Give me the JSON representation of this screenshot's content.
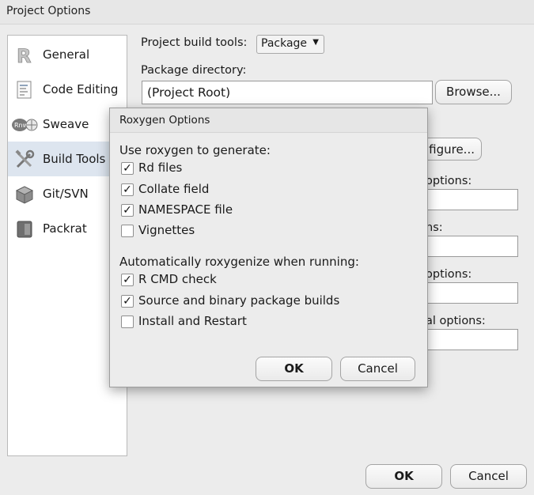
{
  "window": {
    "title": "Project Options"
  },
  "sidebar": {
    "items": [
      {
        "label": "General",
        "icon": "r-logo-icon"
      },
      {
        "label": "Code Editing",
        "icon": "code-editing-icon"
      },
      {
        "label": "Sweave",
        "icon": "sweave-icon"
      },
      {
        "label": "Build Tools",
        "icon": "build-tools-icon",
        "selected": true
      },
      {
        "label": "Git/SVN",
        "icon": "git-svn-icon"
      },
      {
        "label": "Packrat",
        "icon": "packrat-icon"
      }
    ]
  },
  "main": {
    "build_tools_label": "Project build tools:",
    "build_tools_value": "Package",
    "package_dir_label": "Package directory:",
    "package_dir_value": "(Project Root)",
    "browse_label": "Browse...",
    "configure_fragment": "figure...",
    "options_fragment_1": "options:",
    "options_fragment_2": "ns:",
    "options_fragment_3": "options:",
    "options_fragment_4": "al options:"
  },
  "dialog": {
    "title": "Roxygen Options",
    "generate_heading": "Use roxygen to generate:",
    "generate_options": [
      {
        "label": "Rd files",
        "checked": true
      },
      {
        "label": "Collate field",
        "checked": true
      },
      {
        "label": "NAMESPACE file",
        "checked": true
      },
      {
        "label": "Vignettes",
        "checked": false
      }
    ],
    "auto_heading": "Automatically roxygenize when running:",
    "auto_options": [
      {
        "label": "R CMD check",
        "checked": true
      },
      {
        "label": "Source and binary package builds",
        "checked": true
      },
      {
        "label": "Install and Restart",
        "checked": false
      }
    ],
    "ok_label": "OK",
    "cancel_label": "Cancel"
  },
  "footer": {
    "ok_label": "OK",
    "cancel_label": "Cancel"
  }
}
